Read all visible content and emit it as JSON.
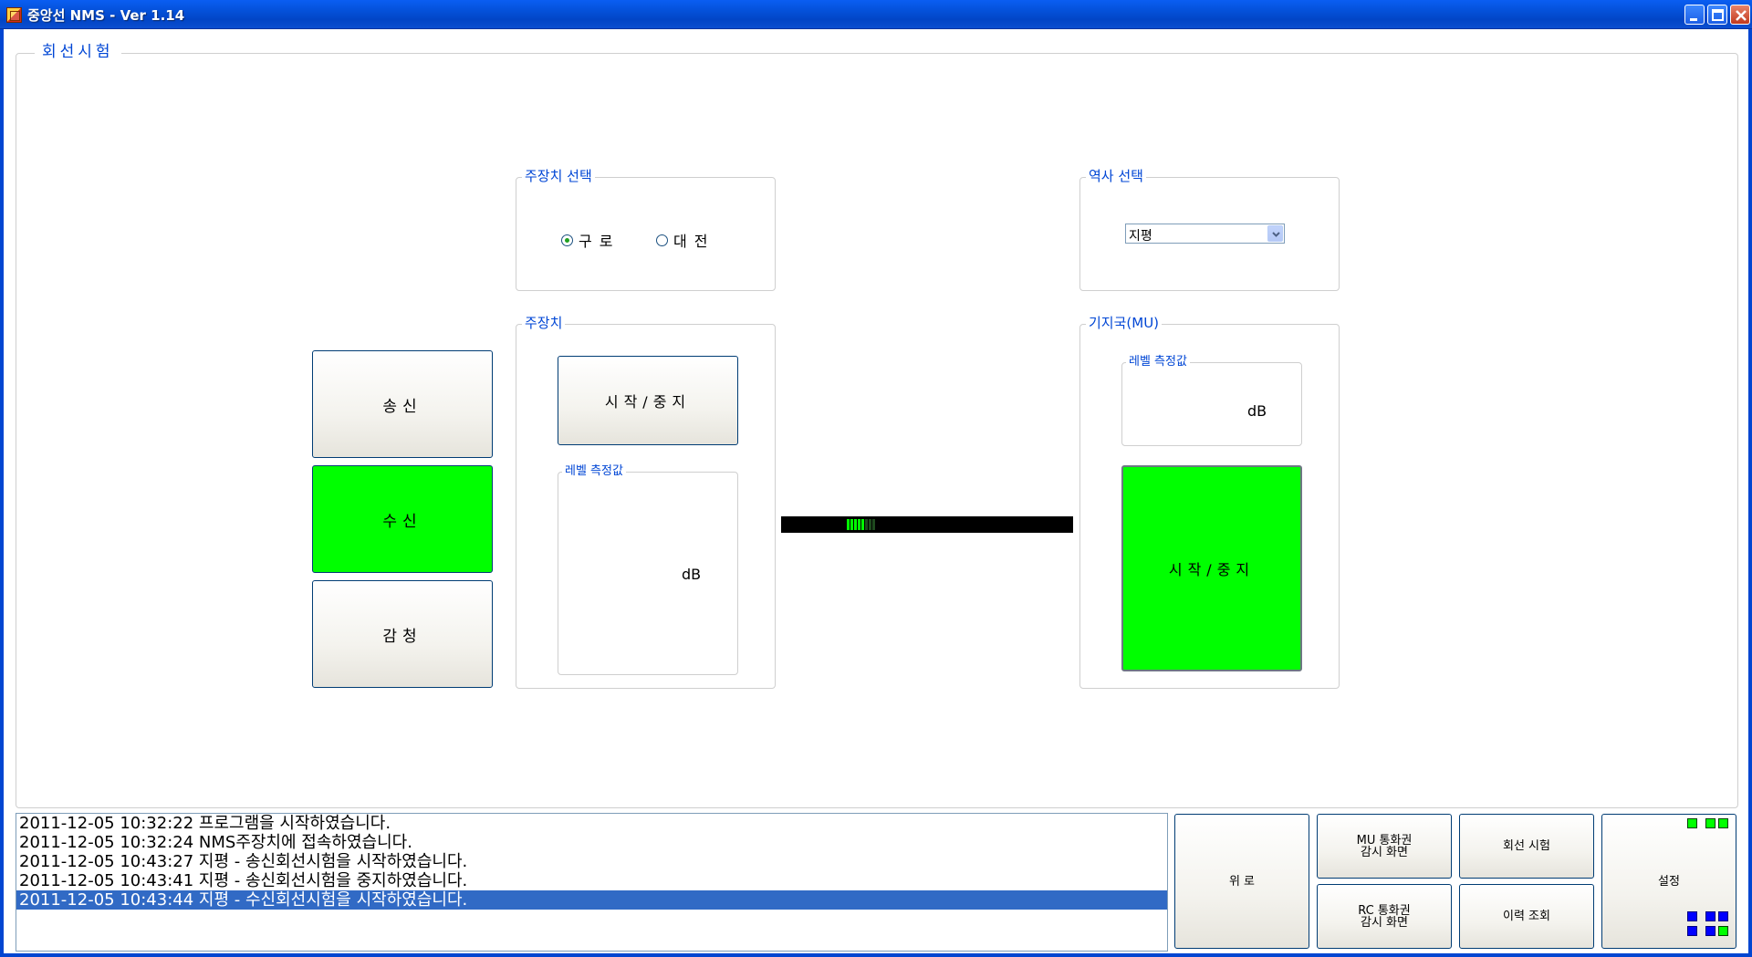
{
  "window": {
    "title": "중앙선 NMS  - Ver 1.14"
  },
  "main": {
    "group_title": "회선시험",
    "device_select": {
      "title": "주장치 선택",
      "options": [
        {
          "label": "구로",
          "checked": true
        },
        {
          "label": "대전",
          "checked": false
        }
      ]
    },
    "station_select": {
      "title": "역사 선택",
      "selected": "지평"
    },
    "mode_buttons": [
      {
        "label": "송신",
        "active": false
      },
      {
        "label": "수신",
        "active": true
      },
      {
        "label": "감청",
        "active": false
      }
    ],
    "main_device": {
      "title": "주장치",
      "start_stop": "시작/중지",
      "level_title": "레벨 측정값",
      "level_unit": "dB"
    },
    "base_station": {
      "title": "기지국(MU)",
      "level_title": "레벨 측정값",
      "level_unit": "dB",
      "start_stop": "시작/중지",
      "start_stop_active": true
    },
    "signal_level": {
      "lit_segments": 5,
      "total_segments": 8
    }
  },
  "log": {
    "entries": [
      "2011-12-05 10:32:22 프로그램을 시작하였습니다.",
      "2011-12-05 10:32:24 NMS주장치에 접속하였습니다.",
      "2011-12-05 10:43:27 지평 - 송신회선시험을 시작하였습니다.",
      "2011-12-05 10:43:41 지평 - 송신회선시험을 중지하였습니다.",
      "2011-12-05 10:43:44 지평 - 수신회선시험을 시작하였습니다."
    ],
    "selected_index": 4
  },
  "nav": {
    "wiro": "위 로",
    "mu_monitor": "MU 통화권\n감시 화면",
    "rc_monitor": "RC 통화권\n감시 화면",
    "line_test": "회선 시험",
    "history": "이력 조회",
    "settings": "설정"
  },
  "colors": {
    "active_green": "#00ff00",
    "label_blue": "#0046d5",
    "selection": "#316ac5"
  }
}
